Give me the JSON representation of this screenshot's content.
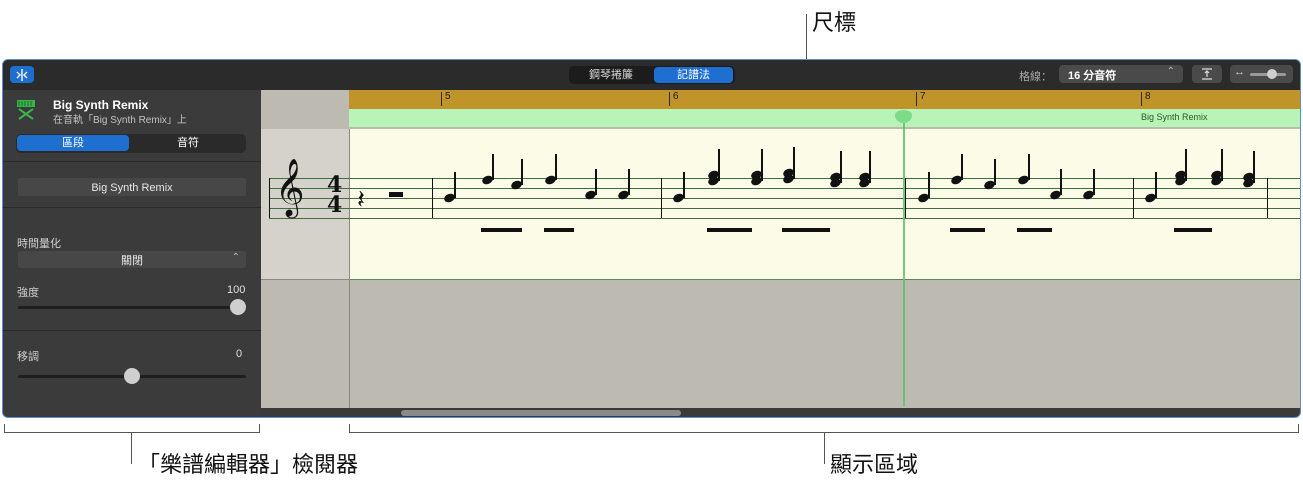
{
  "callouts": {
    "ruler": "尺標",
    "inspector": "「樂譜編輯器」檢閱器",
    "display_area": "顯示區域"
  },
  "toolbar": {
    "view_tabs": [
      {
        "label": "鋼琴捲簾",
        "active": false
      },
      {
        "label": "記譜法",
        "active": true
      }
    ],
    "grid_label": "格線：",
    "grid_value": "16 分音符",
    "icon_left": "catch-playhead-icon",
    "icon_align": "align-icon",
    "icon_zoom": "horizontal-zoom-icon"
  },
  "inspector": {
    "track_name": "Big Synth Remix",
    "track_subtitle": "在音軌「Big Synth Remix」上",
    "tabs": [
      {
        "label": "區段",
        "active": true
      },
      {
        "label": "音符",
        "active": false
      }
    ],
    "region_name": "Big Synth Remix",
    "quantize_label": "時間量化",
    "quantize_value": "關閉",
    "strength_label": "強度",
    "strength_value": "100",
    "strength_level": 1.0,
    "transpose_label": "移調",
    "transpose_value": "0",
    "transpose_level": 0.5
  },
  "ruler": {
    "bars": [
      "5",
      "6",
      "7",
      "8"
    ],
    "region_label": "Big Synth Remix"
  },
  "score": {
    "time_signature_top": "4",
    "time_signature_bottom": "4"
  },
  "colors": {
    "accent": "#1f6fd1",
    "ruler": "#c09428",
    "region": "#b8f3b8",
    "playhead": "#5fbf6a"
  }
}
